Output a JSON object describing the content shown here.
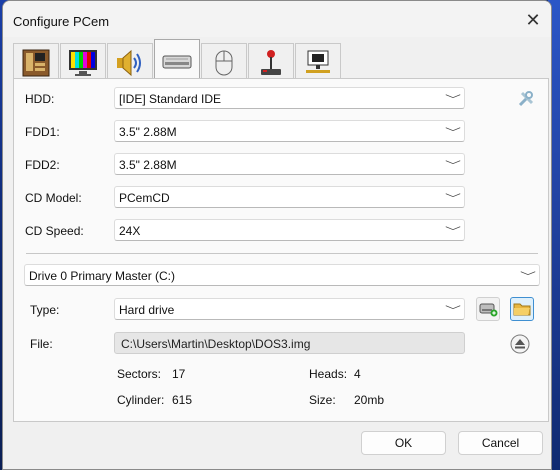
{
  "window": {
    "title": "Configure PCem",
    "close_glyph": "✕"
  },
  "tabs": [
    {
      "icon": "motherboard-icon"
    },
    {
      "icon": "monitor-icon"
    },
    {
      "icon": "speaker-icon"
    },
    {
      "icon": "drive-icon"
    },
    {
      "icon": "mouse-icon"
    },
    {
      "icon": "joystick-icon"
    },
    {
      "icon": "network-icon"
    }
  ],
  "devices": {
    "hdd": {
      "label": "HDD:",
      "value": "[IDE] Standard IDE"
    },
    "fdd1": {
      "label": "FDD1:",
      "value": "3.5\" 2.88M"
    },
    "fdd2": {
      "label": "FDD2:",
      "value": "3.5\" 2.88M"
    },
    "cd_model": {
      "label": "CD Model:",
      "value": "PCemCD"
    },
    "cd_speed": {
      "label": "CD Speed:",
      "value": "24X"
    }
  },
  "drive": {
    "selected": "Drive 0 Primary Master (C:)",
    "type_label": "Type:",
    "type_value": "Hard drive",
    "file_label": "File:",
    "file_value": "C:\\Users\\Martin\\Desktop\\DOS3.img",
    "sectors_label": "Sectors:",
    "sectors_value": "17",
    "heads_label": "Heads:",
    "heads_value": "4",
    "cylinder_label": "Cylinder:",
    "cylinder_value": "615",
    "size_label": "Size:",
    "size_value": "20mb"
  },
  "buttons": {
    "ok": "OK",
    "cancel": "Cancel"
  },
  "icons": {
    "chevron": "﹀"
  }
}
